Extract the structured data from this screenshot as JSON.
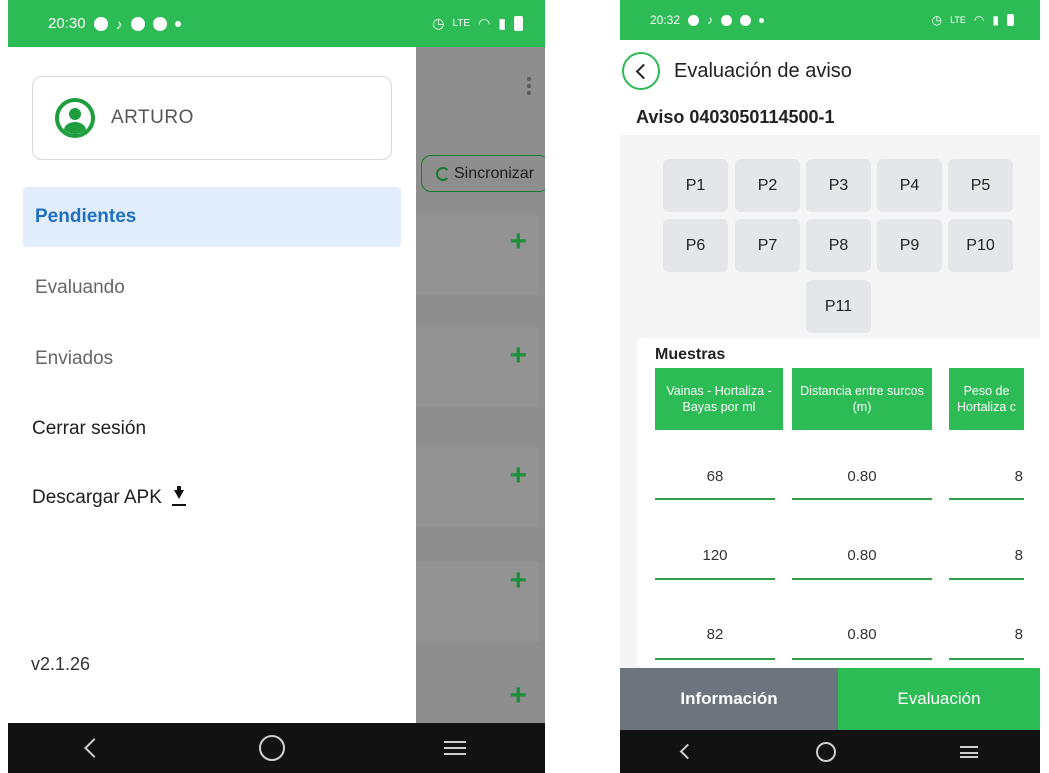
{
  "left_screen": {
    "status": {
      "time": "20:30"
    },
    "background": {
      "sync_label": "Sincronizar",
      "add_icon": "plus-icon"
    },
    "drawer": {
      "user_name": "ARTURO",
      "menu": [
        {
          "label": "Pendientes",
          "active": true
        },
        {
          "label": "Evaluando",
          "active": false
        },
        {
          "label": "Enviados",
          "active": false
        },
        {
          "label": "Cerrar sesión",
          "active": false
        },
        {
          "label": "Descargar APK",
          "active": false,
          "icon": "download-icon"
        }
      ],
      "version": "v2.1.26"
    }
  },
  "right_screen": {
    "status": {
      "time": "20:32"
    },
    "header": {
      "title": "Evaluación de aviso"
    },
    "aviso": "Aviso 0403050114500-1",
    "points": [
      "P1",
      "P2",
      "P3",
      "P4",
      "P5",
      "P6",
      "P7",
      "P8",
      "P9",
      "P10",
      "P11"
    ],
    "muestras": {
      "title": "Muestras",
      "columns": [
        "Vainas - Hortaliza -Bayas por ml",
        "Distancia entre surcos (m)",
        "Peso de Hortaliza c"
      ],
      "rows": [
        [
          "68",
          "0.80",
          "8"
        ],
        [
          "120",
          "0.80",
          "8"
        ],
        [
          "82",
          "0.80",
          "8"
        ]
      ]
    },
    "tabs": {
      "info": "Información",
      "eval": "Evaluación"
    }
  },
  "colors": {
    "accent_green": "#2dbb55",
    "active_blue": "#1f6fc2",
    "active_bg": "#e1edfc",
    "tab_gray": "#6c757d"
  }
}
